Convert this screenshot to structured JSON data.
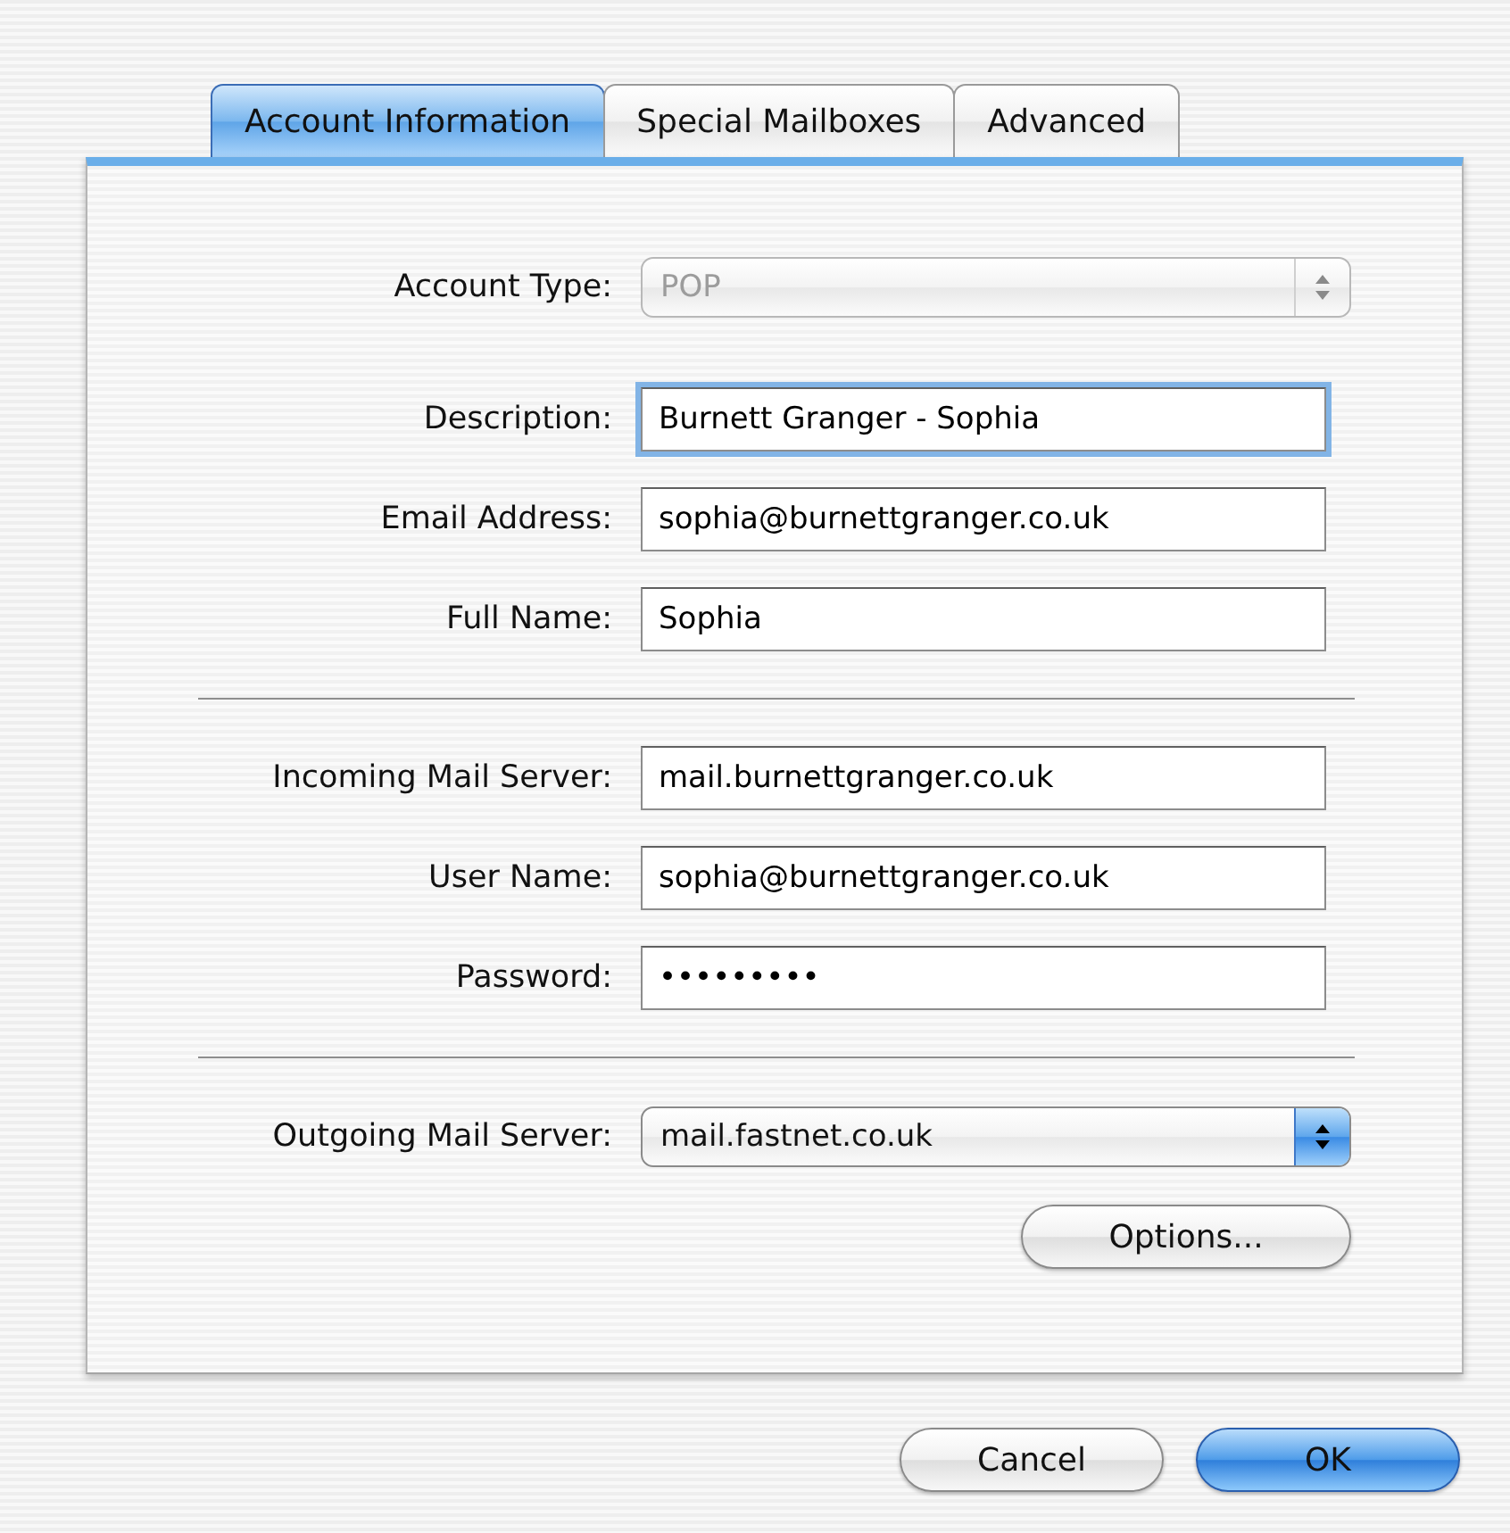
{
  "tabs": [
    {
      "label": "Account Information",
      "selected": true
    },
    {
      "label": "Special Mailboxes",
      "selected": false
    },
    {
      "label": "Advanced",
      "selected": false
    }
  ],
  "sections": [
    {
      "fields": [
        {
          "kind": "popup",
          "label": "Account Type:",
          "value": "POP",
          "disabled": true
        },
        {
          "kind": "text",
          "label": "Description:",
          "value": "Burnett Granger - Sophia",
          "focused": true
        },
        {
          "kind": "text",
          "label": "Email Address:",
          "value": "sophia@burnettgranger.co.uk",
          "focused": false
        },
        {
          "kind": "text",
          "label": "Full Name:",
          "value": "Sophia",
          "focused": false
        }
      ]
    },
    {
      "fields": [
        {
          "kind": "text",
          "label": "Incoming Mail Server:",
          "value": "mail.burnettgranger.co.uk",
          "focused": false
        },
        {
          "kind": "text",
          "label": "User Name:",
          "value": "sophia@burnettgranger.co.uk",
          "focused": false
        },
        {
          "kind": "password",
          "label": "Password:",
          "value": "•••••••••",
          "focused": false
        }
      ]
    },
    {
      "fields": [
        {
          "kind": "popup",
          "label": "Outgoing Mail Server:",
          "value": "mail.fastnet.co.uk",
          "disabled": false
        }
      ]
    }
  ],
  "options_button": "Options...",
  "buttons": [
    {
      "label": "Cancel",
      "default": false
    },
    {
      "label": "OK",
      "default": true
    }
  ]
}
